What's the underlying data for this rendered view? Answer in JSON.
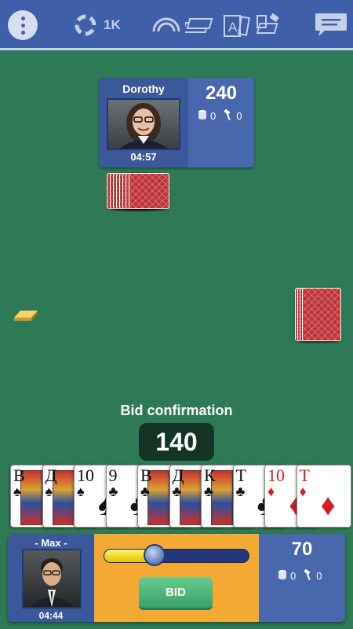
{
  "topbar": {
    "coins_label": "1K",
    "icons": [
      "menu-icon",
      "lifebuoy-icon",
      "rainbow-icon",
      "card-stack-icon",
      "card-a-icon",
      "cards-gavel-icon",
      "chat-icon"
    ]
  },
  "opponent": {
    "name": "Dorothy",
    "timer": "04:57",
    "score": "240",
    "coins": "0",
    "wins": "0"
  },
  "table": {
    "bid_title": "Bid confirmation",
    "bid_value": "140"
  },
  "hand": [
    {
      "rank": "В",
      "suit": "♠",
      "color": "black",
      "face": true
    },
    {
      "rank": "Д",
      "suit": "♠",
      "color": "black",
      "face": true
    },
    {
      "rank": "10",
      "suit": "♠",
      "color": "black",
      "face": false
    },
    {
      "rank": "9",
      "suit": "♣",
      "color": "black",
      "face": false
    },
    {
      "rank": "В",
      "suit": "♣",
      "color": "black",
      "face": true
    },
    {
      "rank": "Д",
      "suit": "♣",
      "color": "black",
      "face": true
    },
    {
      "rank": "К",
      "suit": "♣",
      "color": "black",
      "face": true
    },
    {
      "rank": "Т",
      "suit": "♣",
      "color": "black",
      "face": false
    },
    {
      "rank": "10",
      "suit": "♦",
      "color": "red",
      "face": false
    },
    {
      "rank": "Т",
      "suit": "♦",
      "color": "red",
      "face": false
    }
  ],
  "player": {
    "name": "- Max -",
    "timer": "04:44",
    "score": "70",
    "coins": "0",
    "wins": "0",
    "bid_button": "BID",
    "slider_fraction": 0.35
  },
  "colors": {
    "table_green": "#2f7a56",
    "panel_blue": "#4967ad",
    "accent_orange": "#f4a934",
    "bid_green": "#4cb97b",
    "card_back_red": "#c0343a"
  }
}
